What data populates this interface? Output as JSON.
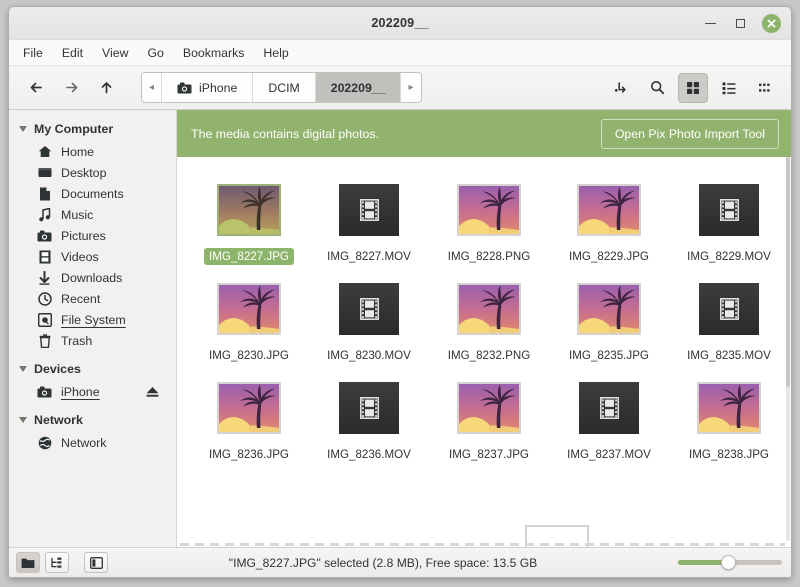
{
  "window": {
    "title": "202209__",
    "minimize_label": "Minimize",
    "maximize_label": "Maximize",
    "close_label": "Close"
  },
  "menubar": {
    "items": [
      {
        "label": "File"
      },
      {
        "label": "Edit"
      },
      {
        "label": "View"
      },
      {
        "label": "Go"
      },
      {
        "label": "Bookmarks"
      },
      {
        "label": "Help"
      }
    ]
  },
  "toolbar": {
    "back_label": "Back",
    "forward_label": "Forward",
    "up_label": "Up",
    "breadcrumb": {
      "left_arrow": "◂",
      "right_arrow": "▸",
      "items": [
        {
          "label": "iPhone",
          "icon": "camera-icon",
          "active": false
        },
        {
          "label": "DCIM",
          "icon": "",
          "active": false
        },
        {
          "label": "202209__",
          "icon": "",
          "active": true
        }
      ]
    },
    "right_buttons": [
      {
        "name": "path-entry-toggle",
        "label": "Toggle location entry"
      },
      {
        "name": "search",
        "label": "Search"
      },
      {
        "name": "icon-view",
        "label": "Icon view",
        "active": true
      },
      {
        "name": "list-view",
        "label": "List view",
        "active": false
      },
      {
        "name": "compact-view",
        "label": "Compact view",
        "active": false
      }
    ]
  },
  "sidebar": {
    "groups": [
      {
        "name": "my-computer",
        "label": "My Computer",
        "items": [
          {
            "label": "Home",
            "icon": "home-icon",
            "underline": false,
            "eject": false
          },
          {
            "label": "Desktop",
            "icon": "desktop-icon",
            "underline": false,
            "eject": false
          },
          {
            "label": "Documents",
            "icon": "document-icon",
            "underline": false,
            "eject": false
          },
          {
            "label": "Music",
            "icon": "music-note-icon",
            "underline": false,
            "eject": false
          },
          {
            "label": "Pictures",
            "icon": "camera-icon",
            "underline": false,
            "eject": false
          },
          {
            "label": "Videos",
            "icon": "film-icon",
            "underline": false,
            "eject": false
          },
          {
            "label": "Downloads",
            "icon": "download-arrow-icon",
            "underline": false,
            "eject": false
          },
          {
            "label": "Recent",
            "icon": "clock-icon",
            "underline": false,
            "eject": false
          },
          {
            "label": "File System",
            "icon": "harddisk-icon",
            "underline": true,
            "eject": false
          },
          {
            "label": "Trash",
            "icon": "trash-icon",
            "underline": false,
            "eject": false
          }
        ]
      },
      {
        "name": "devices",
        "label": "Devices",
        "items": [
          {
            "label": "iPhone",
            "icon": "camera-icon",
            "underline": true,
            "eject": true
          }
        ]
      },
      {
        "name": "network",
        "label": "Network",
        "items": [
          {
            "label": "Network",
            "icon": "globe-icon",
            "underline": false,
            "eject": false
          }
        ]
      }
    ]
  },
  "infobar": {
    "message": "The media contains digital photos.",
    "button_label": "Open Pix Photo Import Tool",
    "background_color": "#92b36d"
  },
  "files": {
    "rows": [
      [
        {
          "name": "IMG_8227.JPG",
          "type": "image",
          "selected": true
        },
        {
          "name": "IMG_8227.MOV",
          "type": "video",
          "selected": false
        },
        {
          "name": "IMG_8228.PNG",
          "type": "image",
          "selected": false
        },
        {
          "name": "IMG_8229.JPG",
          "type": "image",
          "selected": false
        },
        {
          "name": "IMG_8229.MOV",
          "type": "video",
          "selected": false
        }
      ],
      [
        {
          "name": "IMG_8230.JPG",
          "type": "image",
          "selected": false
        },
        {
          "name": "IMG_8230.MOV",
          "type": "video",
          "selected": false
        },
        {
          "name": "IMG_8232.PNG",
          "type": "image",
          "selected": false
        },
        {
          "name": "IMG_8235.JPG",
          "type": "image",
          "selected": false
        },
        {
          "name": "IMG_8235.MOV",
          "type": "video",
          "selected": false
        }
      ],
      [
        {
          "name": "IMG_8236.JPG",
          "type": "image",
          "selected": false
        },
        {
          "name": "IMG_8236.MOV",
          "type": "video",
          "selected": false
        },
        {
          "name": "IMG_8237.JPG",
          "type": "image",
          "selected": false
        },
        {
          "name": "IMG_8237.MOV",
          "type": "video",
          "selected": false
        },
        {
          "name": "IMG_8238.JPG",
          "type": "image",
          "selected": false
        }
      ]
    ]
  },
  "statusbar": {
    "buttons": [
      {
        "name": "folder-view-button",
        "label": "Places",
        "active": true
      },
      {
        "name": "tree-view-button",
        "label": "Tree",
        "active": false
      },
      {
        "name": "sidebar-toggle-button",
        "label": "Toggle sidebar",
        "active": false
      }
    ],
    "text": "\"IMG_8227.JPG\" selected (2.8 MB), Free space: 13.5 GB",
    "zoom": {
      "label": "Zoom",
      "value": 45,
      "fill_color": "#8cb46a"
    }
  }
}
